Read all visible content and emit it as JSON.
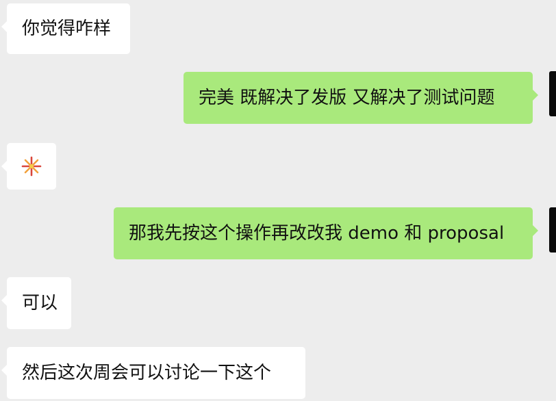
{
  "messages": [
    {
      "side": "in",
      "text": "你觉得咋样"
    },
    {
      "side": "out",
      "text": "完美 既解决了发版 又解决了测试问题"
    },
    {
      "side": "in",
      "icon": "fireworks-emoji-icon"
    },
    {
      "side": "out",
      "text": "那我先按这个操作再改改我 demo 和 proposal"
    },
    {
      "side": "in",
      "text": "可以"
    },
    {
      "side": "in",
      "text": "然后这次周会可以讨论一下这个"
    }
  ],
  "colors": {
    "background": "#ededed",
    "incoming_bubble": "#ffffff",
    "outgoing_bubble": "#a9e97c",
    "text": "#111111"
  }
}
